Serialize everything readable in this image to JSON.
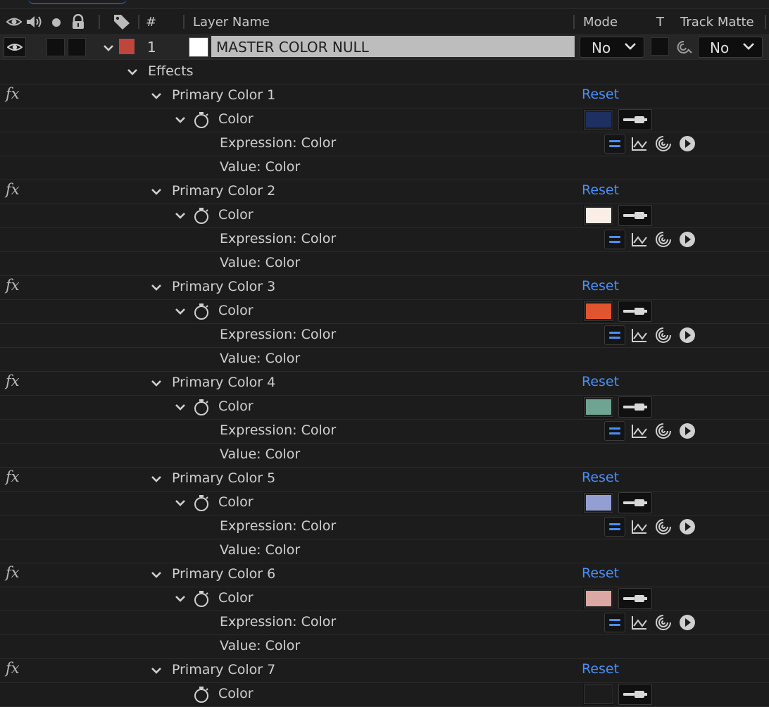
{
  "header": {
    "hash_label": "#",
    "layer_name_label": "Layer Name",
    "mode_label": "Mode",
    "t_label": "T",
    "track_matte_label": "Track Matte"
  },
  "layer": {
    "number": "1",
    "name": "MASTER COLOR NULL",
    "mode_value": "No",
    "track_matte_value": "No",
    "label_color": "#c0453c"
  },
  "effects_group_label": "Effects",
  "effects": [
    {
      "name": "Primary Color 1",
      "reset_label": "Reset",
      "prop_label": "Color",
      "color": "#1e3060",
      "expr_label": "Expression: Color",
      "value_label": "Value: Color"
    },
    {
      "name": "Primary Color 2",
      "reset_label": "Reset",
      "prop_label": "Color",
      "color": "#fbeee6",
      "expr_label": "Expression: Color",
      "value_label": "Value: Color"
    },
    {
      "name": "Primary Color 3",
      "reset_label": "Reset",
      "prop_label": "Color",
      "color": "#e0552f",
      "expr_label": "Expression: Color",
      "value_label": "Value: Color"
    },
    {
      "name": "Primary Color 4",
      "reset_label": "Reset",
      "prop_label": "Color",
      "color": "#6fa493",
      "expr_label": "Expression: Color",
      "value_label": "Value: Color"
    },
    {
      "name": "Primary Color 5",
      "reset_label": "Reset",
      "prop_label": "Color",
      "color": "#939fd2",
      "expr_label": "Expression: Color",
      "value_label": "Value: Color"
    },
    {
      "name": "Primary Color 6",
      "reset_label": "Reset",
      "prop_label": "Color",
      "color": "#dba8a3",
      "expr_label": "Expression: Color",
      "value_label": "Value: Color"
    },
    {
      "name": "Primary Color 7",
      "reset_label": "Reset",
      "prop_label": "Color",
      "color": "#1c1c1c"
    }
  ],
  "colors": {
    "accent_blue": "#4a8ff7",
    "background": "#1c1c1c",
    "text": "#cfcfcf"
  }
}
